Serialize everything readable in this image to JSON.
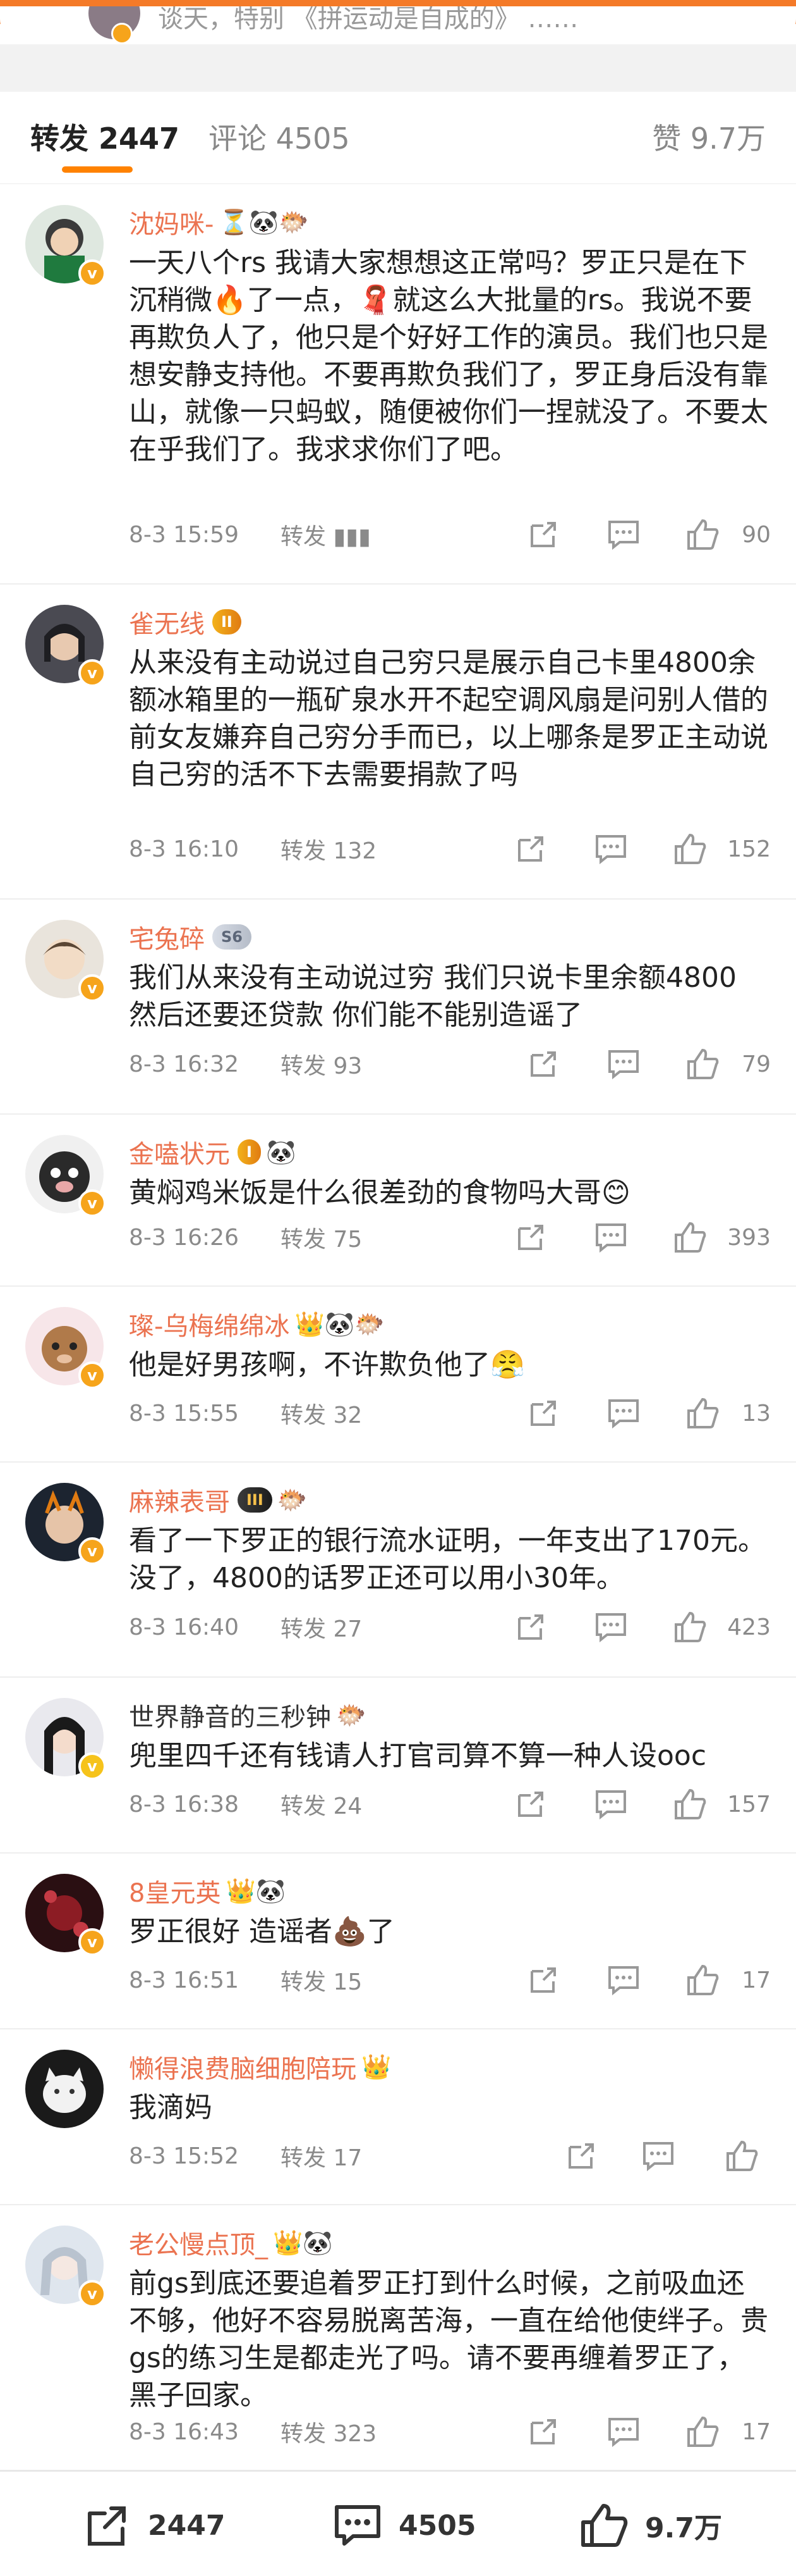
{
  "header": {
    "fragment_text": "谈天，特别 《拼运动是自成的》 ……"
  },
  "tabs": {
    "reposts": "转发 2447",
    "comments": "评论 4505",
    "likes": "赞 9.7万"
  },
  "comments": [
    {
      "name": "沈妈咪-",
      "badge": "",
      "glyphs": "⏳🐼🐡",
      "text": "一天八个rs 我请大家想想这正常吗？罗正只是在下沉稍微🔥了一点，🧣就这么大批量的rs。我说不要再欺负人了，他只是个好好工作的演员。我们也只是想安静支持他。不要再欺负我们了，罗正身后没有靠山，就像一只蚂蚁，随便被你们一捏就没了。不要太在乎我们了。我求求你们了吧。",
      "time": "8-3 15:59",
      "repost": "转发 ▮▮▮",
      "likes": "90"
    },
    {
      "name": "雀无线",
      "badge": "II",
      "glyphs": "",
      "text": "从来没有主动说过自己穷只是展示自己卡里4800余额冰箱里的一瓶矿泉水开不起空调风扇是问别人借的前女友嫌弃自己穷分手而已，以上哪条是罗正主动说自己穷的活不下去需要捐款了吗",
      "time": "8-3 16:10",
      "repost": "转发 132",
      "likes": "152"
    },
    {
      "name": "宅兔碎",
      "badge": "S6",
      "glyphs": "",
      "text": "我们从来没有主动说过穷 我们只说卡里余额4800 然后还要还贷款 你们能不能别造谣了",
      "time": "8-3 16:32",
      "repost": "转发 93",
      "likes": "79"
    },
    {
      "name": "金嗑状元",
      "badge": "I",
      "glyphs": "🐼",
      "text": "黄焖鸡米饭是什么很差劲的食物吗大哥😊",
      "time": "8-3 16:26",
      "repost": "转发 75",
      "likes": "393"
    },
    {
      "name": "璨-乌梅绵绵冰",
      "badge": "",
      "glyphs": "👑🐼🐡",
      "text": "他是好男孩啊，不许欺负他了😤",
      "time": "8-3 15:55",
      "repost": "转发 32",
      "likes": "13"
    },
    {
      "name": "麻辣表哥",
      "badge": "III",
      "glyphs": "🐡",
      "text": "看了一下罗正的银行流水证明，一年支出了170元。没了，4800的话罗正还可以用小30年。",
      "time": "8-3 16:40",
      "repost": "转发 27",
      "likes": "423"
    },
    {
      "name": "世界静音的三秒钟",
      "badge": "",
      "glyphs": "🐡",
      "text": "兜里四千还有钱请人打官司算不算一种人设ooc",
      "time": "8-3 16:38",
      "repost": "转发 24",
      "likes": "157"
    },
    {
      "name": "8皇元英",
      "badge": "",
      "glyphs": "👑🐼",
      "text": "罗正很好 造谣者💩了",
      "time": "8-3 16:51",
      "repost": "转发 15",
      "likes": "17"
    },
    {
      "name": "懒得浪费脑细胞陪玩",
      "badge": "",
      "glyphs": "👑",
      "text": "我滴妈",
      "time": "8-3 15:52",
      "repost": "转发 17",
      "likes": ""
    },
    {
      "name": "老公慢点顶_",
      "badge": "",
      "glyphs": "👑🐼",
      "text": "前gs到底还要追着罗正打到什么时候，之前吸血还不够，他好不容易脱离苦海，一直在给他使绊子。贵gs的练习生是都走光了吗。请不要再缠着罗正了，黑子回家。",
      "time": "8-3 16:43",
      "repost": "转发 323",
      "likes": "17"
    }
  ],
  "bottom_bar": {
    "reposts": "2447",
    "comments": "4505",
    "likes": "9.7万"
  },
  "colors": {
    "accent": "#ff8200",
    "username": "#eb7350",
    "meta": "#8a8a8a"
  }
}
